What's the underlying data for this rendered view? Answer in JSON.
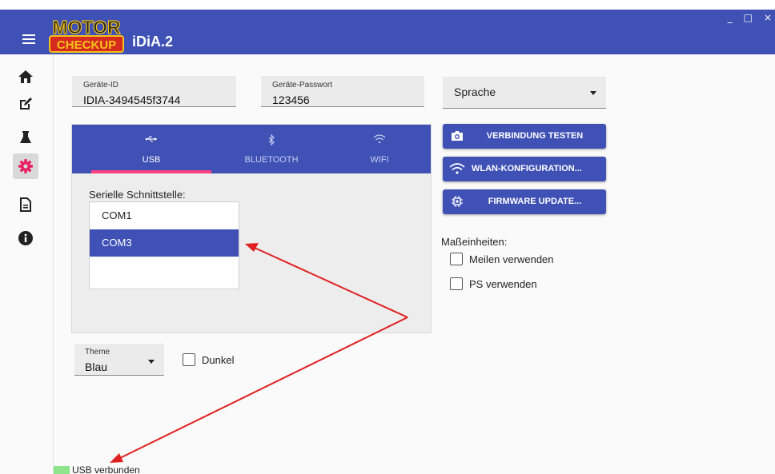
{
  "app": {
    "logo_top": "MOTOR",
    "logo_bottom": "CHECKUP",
    "title": "iDiA.2",
    "brand_color": "#3f51b5",
    "accent_color": "#ff4081"
  },
  "window_controls": {
    "minimize": "_",
    "maximize": "□",
    "close": "×"
  },
  "sidebar": {
    "items": [
      {
        "icon": "home-icon"
      },
      {
        "icon": "edit-icon"
      },
      {
        "icon": "flask-icon"
      },
      {
        "icon": "gear-icon",
        "active": true
      },
      {
        "icon": "document-icon"
      },
      {
        "icon": "info-icon"
      }
    ]
  },
  "device": {
    "id_label": "Geräte-ID",
    "id_value": "IDIA-3494545f3744",
    "password_label": "Geräte-Passwort",
    "password_value": "123456"
  },
  "language": {
    "label": "Sprache"
  },
  "connection": {
    "tabs": [
      {
        "label": "USB",
        "icon": "usb-icon",
        "active": true
      },
      {
        "label": "BLUETOOTH",
        "icon": "bluetooth-icon"
      },
      {
        "label": "WIFI",
        "icon": "wifi-icon"
      }
    ],
    "serial_label": "Serielle Schnittstelle:",
    "ports": [
      "COM1",
      "COM3"
    ],
    "selected_port": "COM3"
  },
  "actions": {
    "test": "VERBINDUNG TESTEN",
    "wlan": "WLAN-KONFIGURATION...",
    "firmware": "FIRMWARE UPDATE..."
  },
  "units": {
    "label": "Maßeinheiten:",
    "miles": "Meilen verwenden",
    "miles_checked": false,
    "ps": "PS verwenden",
    "ps_checked": false
  },
  "theme": {
    "label": "Theme",
    "value": "Blau",
    "dark_label": "Dunkel",
    "dark_checked": false
  },
  "status": {
    "text": "USB verbunden",
    "color": "#8ee58e"
  },
  "annotation": {
    "arrow_color": "#e02020"
  }
}
